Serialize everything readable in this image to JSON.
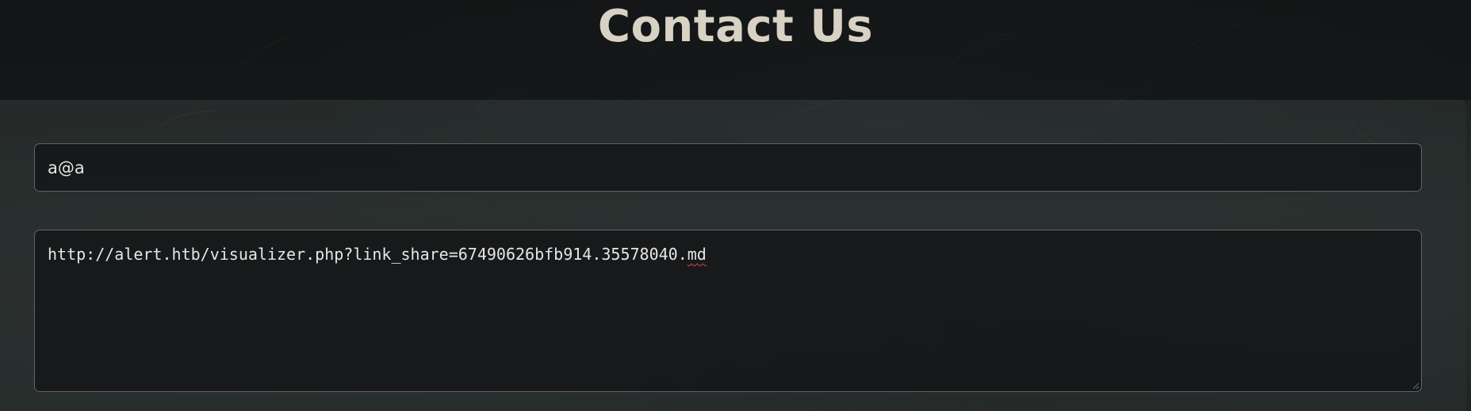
{
  "header": {
    "title": "Contact Us"
  },
  "form": {
    "email": {
      "value": "a@a"
    },
    "message": {
      "value_prefix": "http://alert.htb/visualizer.php?link_share=67490626bfb914.35578040.",
      "value_misspelled": "md"
    }
  },
  "colors": {
    "title": "#d8d2c4",
    "field_background": "#151718",
    "field_border": "#5f6466",
    "field_text": "#e6e6e6",
    "spellcheck_underline": "#e04545"
  }
}
